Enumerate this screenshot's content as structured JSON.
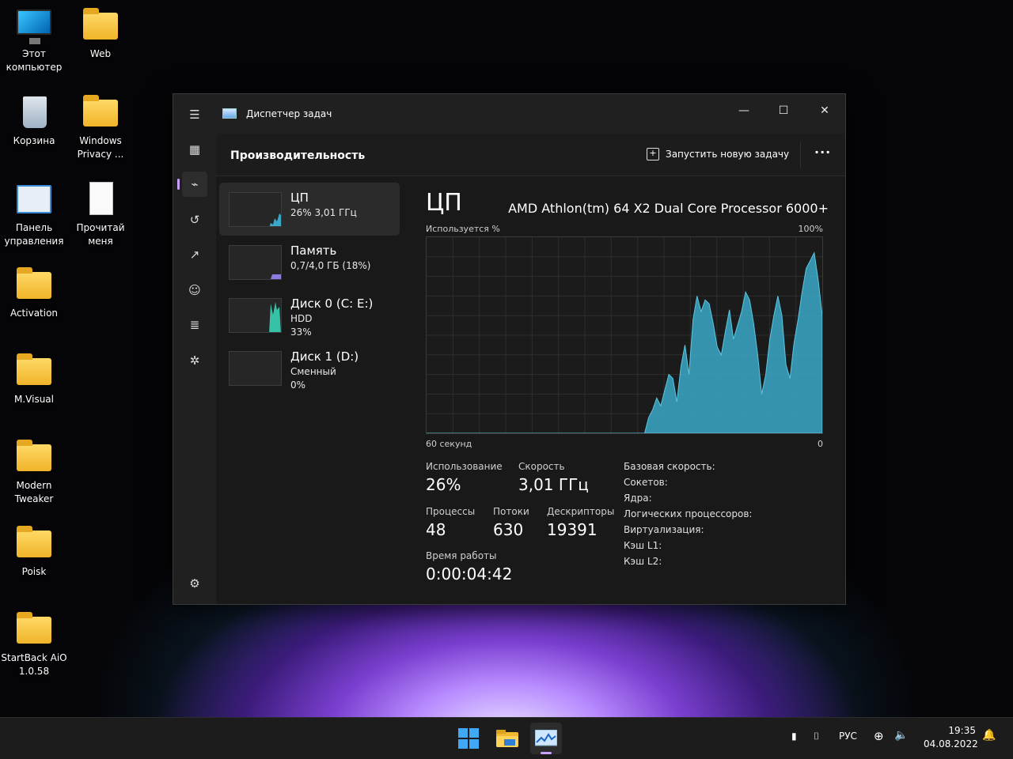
{
  "desktop": {
    "icons": [
      {
        "label": "Этот компьютер",
        "icon": "computer-icon"
      },
      {
        "label": "Web",
        "icon": "folder-icon"
      },
      {
        "label": "Корзина",
        "icon": "recycle-bin-icon"
      },
      {
        "label": "Windows Privacy ...",
        "icon": "folder-icon"
      },
      {
        "label": "Панель управления",
        "icon": "control-panel-icon"
      },
      {
        "label": "Прочитай меня",
        "icon": "text-file-icon"
      },
      {
        "label": "Activation",
        "icon": "folder-icon"
      },
      {
        "label": "M.Visual",
        "icon": "folder-icon"
      },
      {
        "label": "Modern Tweaker",
        "icon": "folder-icon"
      },
      {
        "label": "Poisk",
        "icon": "folder-icon"
      },
      {
        "label": "StartBack AiO 1.0.58",
        "icon": "folder-icon"
      }
    ]
  },
  "window": {
    "title": "Диспетчер задач",
    "section_title": "Производительность",
    "run_task": "Запустить новую задачу",
    "more": "···"
  },
  "resources": [
    {
      "name": "ЦП",
      "line1": "26% 3,01 ГГц",
      "line2": ""
    },
    {
      "name": "Память",
      "line1": "0,7/4,0 ГБ (18%)",
      "line2": ""
    },
    {
      "name": "Диск 0 (C: E:)",
      "line1": "HDD",
      "line2": "33%"
    },
    {
      "name": "Диск 1 (D:)",
      "line1": "Сменный",
      "line2": "0%"
    }
  ],
  "cpu": {
    "title": "ЦП",
    "model": "AMD Athlon(tm) 64 X2 Dual Core Processor 6000+",
    "usage_label": "Используется %",
    "max_label": "100%",
    "time_label": "60 секунд",
    "min_label": "0",
    "usage_stat_label": "Использование",
    "usage_value": "26%",
    "speed_label": "Скорость",
    "speed_value": "3,01 ГГц",
    "processes_label": "Процессы",
    "processes_value": "48",
    "threads_label": "Потоки",
    "threads_value": "630",
    "handles_label": "Дескрипторы",
    "handles_value": "19391",
    "uptime_label": "Время работы",
    "uptime_value": "0:00:04:42",
    "specs": [
      "Базовая скорость:",
      "Сокетов:",
      "Ядра:",
      "Логических процессоров:",
      "Виртуализация:",
      "Кэш L1:",
      "Кэш L2:"
    ]
  },
  "chart_data": {
    "type": "area",
    "title": "",
    "x_range": [
      60,
      0
    ],
    "ylim": [
      0,
      100
    ],
    "y": [
      0,
      0,
      0,
      0,
      0,
      0,
      0,
      0,
      0,
      0,
      0,
      0,
      0,
      0,
      0,
      0,
      0,
      0,
      0,
      0,
      0,
      0,
      0,
      0,
      0,
      0,
      0,
      0,
      0,
      0,
      0,
      0,
      0,
      0,
      0,
      0,
      0,
      0,
      0,
      0,
      0,
      0,
      0,
      0,
      0,
      0,
      0,
      0,
      0,
      0,
      0,
      0,
      0,
      0,
      0,
      8,
      12,
      18,
      14,
      22,
      30,
      28,
      16,
      34,
      45,
      30,
      58,
      70,
      62,
      68,
      66,
      56,
      44,
      40,
      52,
      63,
      48,
      55,
      62,
      72,
      68,
      56,
      40,
      20,
      30,
      48,
      60,
      70,
      60,
      35,
      28,
      46,
      58,
      72,
      84,
      88,
      92,
      78,
      60
    ],
    "color": "#39a8c8"
  },
  "taskbar": {
    "lang": "РУС",
    "time": "19:35",
    "date": "04.08.2022"
  }
}
